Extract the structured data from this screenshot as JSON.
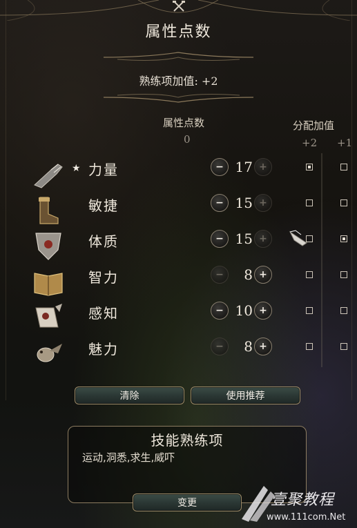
{
  "title": "属性点数",
  "proficiency_bonus": "熟练项加值: +2",
  "headers": {
    "points_label": "属性点数",
    "points_value": "0",
    "assign_label": "分配加值",
    "col_plus2": "+2",
    "col_plus1": "+1"
  },
  "abilities": [
    {
      "name": "力量",
      "value": "17",
      "starred": true,
      "minus_enabled": true,
      "plus2": true,
      "plus1": false,
      "icon": "gauntlet-icon"
    },
    {
      "name": "敏捷",
      "value": "15",
      "starred": false,
      "minus_enabled": true,
      "plus2": false,
      "plus1": false,
      "icon": "boot-icon"
    },
    {
      "name": "体质",
      "value": "15",
      "starred": false,
      "minus_enabled": true,
      "plus2": false,
      "plus1": true,
      "icon": "shield-icon"
    },
    {
      "name": "智力",
      "value": "8",
      "starred": false,
      "minus_enabled": false,
      "plus2": false,
      "plus1": false,
      "icon": "book-icon"
    },
    {
      "name": "感知",
      "value": "10",
      "starred": false,
      "minus_enabled": true,
      "plus2": false,
      "plus1": false,
      "icon": "scroll-icon"
    },
    {
      "name": "魅力",
      "value": "8",
      "starred": false,
      "minus_enabled": false,
      "plus2": false,
      "plus1": false,
      "icon": "bird-icon"
    }
  ],
  "buttons": {
    "clear": "清除",
    "use_recommended": "使用推荐",
    "change": "变更"
  },
  "skills_panel": {
    "title": "技能熟练项",
    "skills": "运动,洞悉,求生,威吓"
  },
  "watermark": {
    "brand": "壹聚教程",
    "url": "www.111com.Net"
  },
  "colors": {
    "accent_gold": "#9c8a67",
    "button_teal": "#2f3d39",
    "text": "#efe8dc"
  }
}
